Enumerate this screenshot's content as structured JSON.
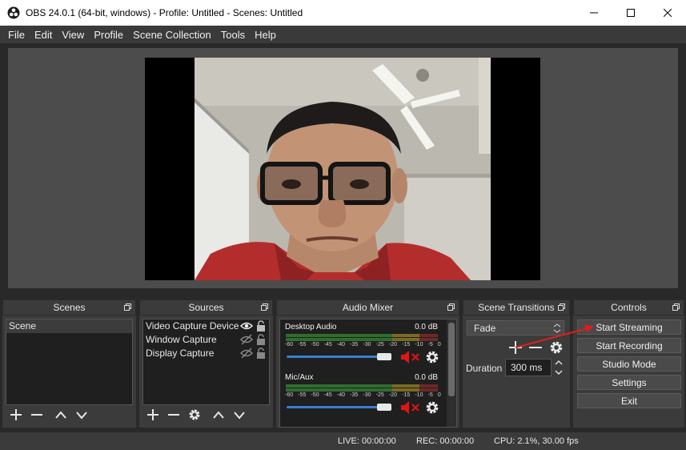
{
  "window": {
    "title": "OBS 24.0.1 (64-bit, windows) - Profile: Untitled - Scenes: Untitled"
  },
  "menu": [
    "File",
    "Edit",
    "View",
    "Profile",
    "Scene Collection",
    "Tools",
    "Help"
  ],
  "docks": {
    "scenes": {
      "title": "Scenes",
      "items": [
        "Scene"
      ]
    },
    "sources": {
      "title": "Sources",
      "items": [
        "Video Capture Device",
        "Window Capture",
        "Display Capture"
      ]
    },
    "audio_mixer": {
      "title": "Audio Mixer",
      "scale": [
        "-60",
        "-55",
        "-50",
        "-45",
        "-40",
        "-35",
        "-30",
        "-25",
        "-20",
        "-15",
        "-10",
        "-5",
        "0"
      ],
      "channels": [
        {
          "name": "Desktop Audio",
          "db": "0.0 dB",
          "volume": 0.9,
          "muted": true
        },
        {
          "name": "Mic/Aux",
          "db": "0.0 dB",
          "volume": 0.9,
          "muted": true
        }
      ]
    },
    "transitions": {
      "title": "Scene Transitions",
      "selected": "Fade",
      "duration_label": "Duration",
      "duration_value": "300 ms"
    },
    "controls": {
      "title": "Controls",
      "buttons": [
        "Start Streaming",
        "Start Recording",
        "Studio Mode",
        "Settings",
        "Exit"
      ]
    }
  },
  "status": {
    "live": "LIVE: 00:00:00",
    "rec": "REC: 00:00:00",
    "cpu": "CPU: 2.1%, 30.00 fps"
  },
  "colors": {
    "annotation_arrow": "#e11c1c",
    "mute_icon": "#e01515",
    "slider": "#3a7ed0"
  }
}
